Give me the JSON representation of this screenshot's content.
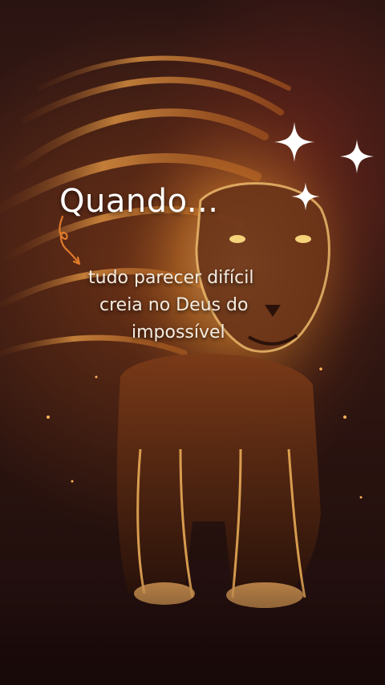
{
  "image": {
    "subject": "fiery-lion-icon"
  },
  "text": {
    "headline": "Quando...",
    "line1": "tudo parecer difícil",
    "line2": "creia no Deus do",
    "line3": "impossível"
  },
  "colors": {
    "text": "#ffffff",
    "arrow": "#e07a2a",
    "fire": "#f0a040",
    "background": "#2a1412"
  },
  "icons": [
    "curly-arrow-icon",
    "sparkle-icon"
  ]
}
